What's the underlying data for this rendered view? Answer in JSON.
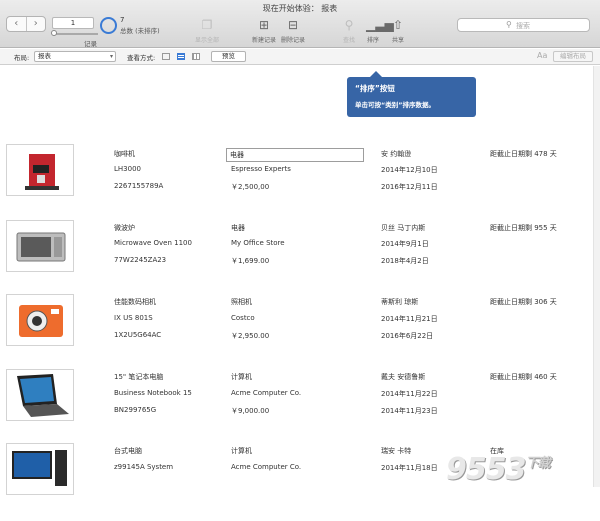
{
  "window": {
    "title": "现在开始体验： 报表"
  },
  "toolbar": {
    "back": "‹",
    "forward": "›",
    "record_number": "1",
    "record_label": "记录",
    "count": "7",
    "total": "总数 (未排序)",
    "show_all": "显示全部",
    "new_record": "新建记录",
    "delete_record": "删除记录",
    "find": "查找",
    "sort": "排序",
    "share": "共享",
    "search_placeholder": "搜索"
  },
  "layout_bar": {
    "layout_label": "布局:",
    "layout_value": "报表",
    "view_as_label": "查看方式:",
    "preview": "预览",
    "aa": "Aa",
    "edit_layout": "编辑布局"
  },
  "tooltip": {
    "title": "“排序”按钮",
    "body": "单击可按“类别”排序数据。"
  },
  "records": [
    {
      "name": "咖啡机",
      "model": "LH3000",
      "serial": "2267155789A",
      "category": "电器",
      "vendor": "Espresso Experts",
      "price": "￥2,500,00",
      "person": "安 约翰逊",
      "date1": "2014年12月10日",
      "date2": "2016年12月11日",
      "status": "距截止日期剩 478 天"
    },
    {
      "name": "微波炉",
      "model": "Microwave Oven 1100",
      "serial": "77W2245ZA23",
      "category": "电器",
      "vendor": "My Office Store",
      "price": "￥1,699.00",
      "person": "贝丝 马丁内斯",
      "date1": "2014年9月1日",
      "date2": "2018年4月2日",
      "status": "距截止日期剩 955 天"
    },
    {
      "name": "佳能数码相机",
      "model": "IX US 801S",
      "serial": "1X2U5G64AC",
      "category": "照相机",
      "vendor": "Costco",
      "price": "￥2,950.00",
      "person": "蒂斯利 琼斯",
      "date1": "2014年11月21日",
      "date2": "2016年6月22日",
      "status": "距截止日期剩 306 天"
    },
    {
      "name": "15\" 笔记本电脑",
      "model": "Business Notebook 15",
      "serial": "BN299765G",
      "category": "计算机",
      "vendor": "Acme Computer Co.",
      "price": "￥9,000.00",
      "person": "戴夫 安德鲁斯",
      "date1": "2014年11月22日",
      "date2": "2014年11月23日",
      "status": "距截止日期剩 460 天"
    },
    {
      "name": "台式电脑",
      "model": "z99145A System",
      "serial": "",
      "category": "计算机",
      "vendor": "Acme Computer Co.",
      "price": "",
      "person": "瑞安 卡特",
      "date1": "2014年11月18日",
      "date2": "",
      "status": "在库"
    }
  ],
  "watermark": {
    "text": "9553",
    "sub": "下载"
  }
}
